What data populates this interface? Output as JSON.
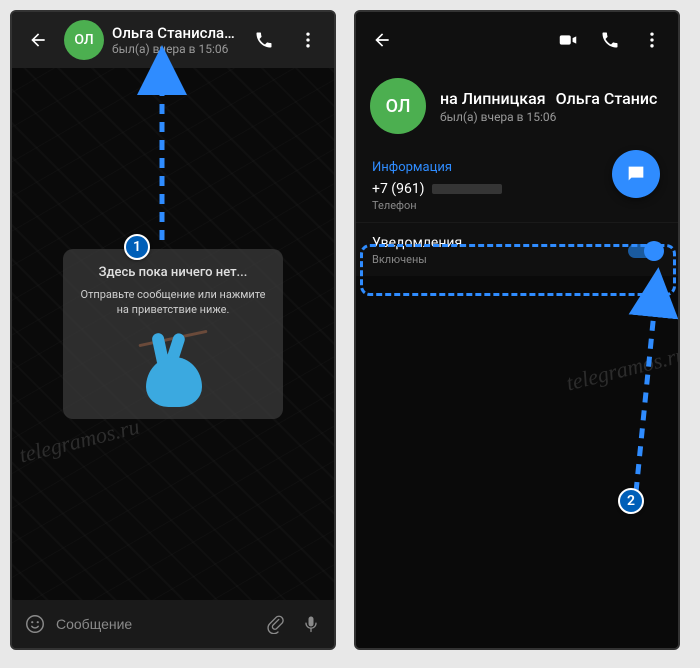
{
  "left": {
    "avatar_initials": "ОЛ",
    "title": "Ольга Станиславо...",
    "subtitle": "был(а) вчера в 15:06",
    "placeholder": {
      "title": "Здесь пока ничего нет...",
      "desc": "Отправьте сообщение или нажмите на приветствие ниже."
    },
    "input_placeholder": "Сообщение"
  },
  "right": {
    "avatar_initials": "ОЛ",
    "name_part1": "на Липницкая",
    "name_part2": "Ольга Станис",
    "subtitle": "был(а) вчера в 15:06",
    "info_label": "Информация",
    "phone_value": "+7 (961)",
    "phone_label": "Телефон",
    "notifications_label": "Уведомления",
    "notifications_state": "Включены"
  },
  "watermark": "telegramos.ru",
  "badges": {
    "one": "1",
    "two": "2"
  }
}
